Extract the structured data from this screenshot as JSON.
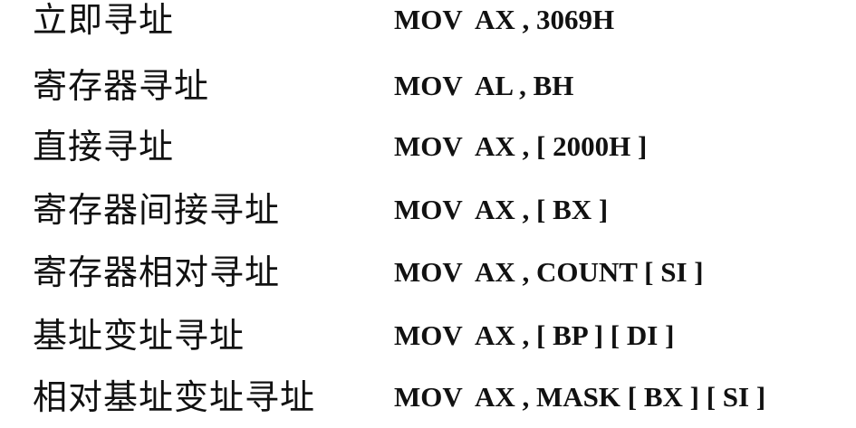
{
  "rows": [
    {
      "mode": "立即寻址",
      "instruction": "MOV  AX , 3069H"
    },
    {
      "mode": "寄存器寻址",
      "instruction": "MOV  AL , BH"
    },
    {
      "mode": "直接寻址",
      "instruction": "MOV  AX , [ 2000H ]"
    },
    {
      "mode": "寄存器间接寻址",
      "instruction": "MOV  AX , [ BX ]"
    },
    {
      "mode": "寄存器相对寻址",
      "instruction": "MOV  AX , COUNT [ SI ]"
    },
    {
      "mode": "基址变址寻址",
      "instruction": "MOV  AX , [ BP ] [ DI ]"
    },
    {
      "mode": "相对基址变址寻址",
      "instruction": "MOV  AX , MASK [ BX ] [ SI ]"
    }
  ]
}
